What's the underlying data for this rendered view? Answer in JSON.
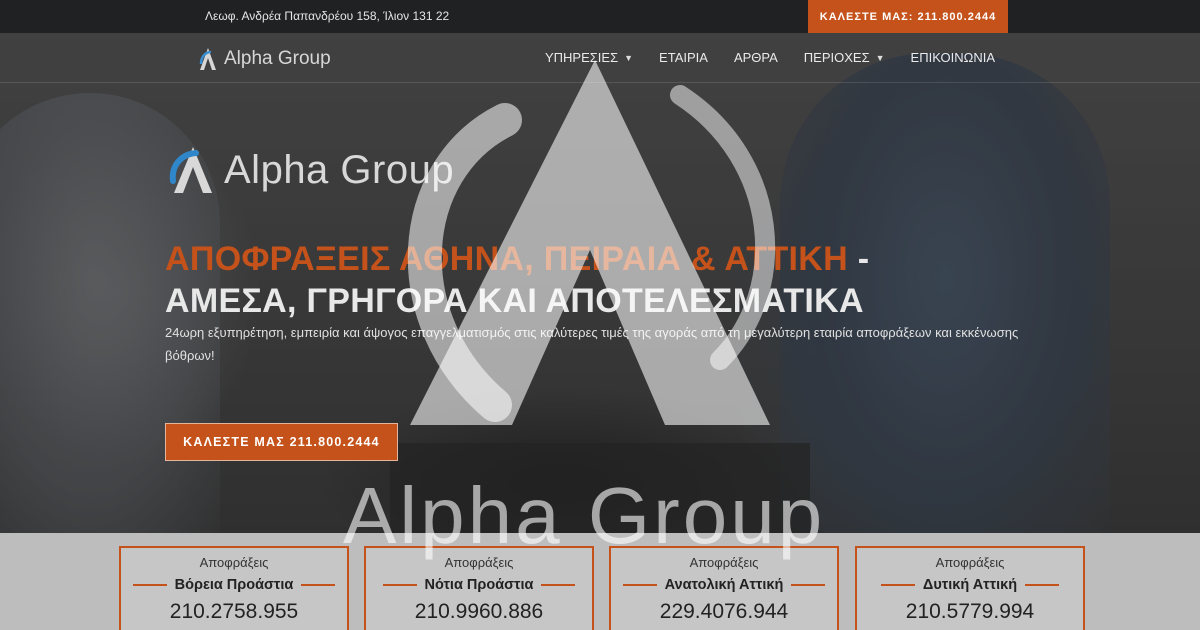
{
  "topbar": {
    "address": "Λεωφ. Ανδρέα Παπανδρέου 158, Ίλιον 131 22",
    "call_label": "ΚΑΛΕΣΤΕ ΜΑΣ: 211.800.2444"
  },
  "nav": {
    "brand": "Alpha Group",
    "menu": [
      {
        "label": "ΥΠΗΡΕΣΙΕΣ",
        "has_dropdown": true
      },
      {
        "label": "ΕΤΑΙΡΙΑ",
        "has_dropdown": false
      },
      {
        "label": "ΑΡΘΡΑ",
        "has_dropdown": false
      },
      {
        "label": "ΠΕΡΙΟΧΕΣ",
        "has_dropdown": true
      },
      {
        "label": "ΕΠΙΚΟΙΝΩΝΙΑ",
        "has_dropdown": false
      }
    ]
  },
  "hero": {
    "logo_text": "Alpha Group",
    "headline_orange": "ΑΠΟΦΡΑΞΕΙΣ ΑΘΗΝΑ, ΠΕΙΡΑΙΑ & ΑΤΤΙΚΗ",
    "headline_sep": " -",
    "headline_white": "ΑΜΕΣΑ, ΓΡΗΓΟΡΑ ΚΑΙ ΑΠΟΤΕΛΕΣΜΑΤΙΚΑ",
    "subtext": "24ωρη εξυπηρέτηση, εμπειρία και άψογος επαγγελματισμός στις καλύτερες τιμές της αγοράς από τη μεγαλύτερη εταιρία αποφράξεων και εκκένωσης βόθρων!",
    "cta_label": "ΚΑΛΕΣΤΕ ΜΑΣ 211.800.2444"
  },
  "watermark": {
    "text": "Alpha Group"
  },
  "cards": [
    {
      "small": "Αποφράξεις",
      "region": "Βόρεια Προάστια",
      "phone": "210.2758.955"
    },
    {
      "small": "Αποφράξεις",
      "region": "Νότια Προάστια",
      "phone": "210.9960.886"
    },
    {
      "small": "Αποφράξεις",
      "region": "Ανατολική Αττική",
      "phone": "229.4076.944"
    },
    {
      "small": "Αποφράξεις",
      "region": "Δυτική Αττική",
      "phone": "210.5779.994"
    }
  ],
  "colors": {
    "accent": "#c4521a",
    "topbar_bg": "#1f2123",
    "strip_bg": "#bdbdbd"
  }
}
